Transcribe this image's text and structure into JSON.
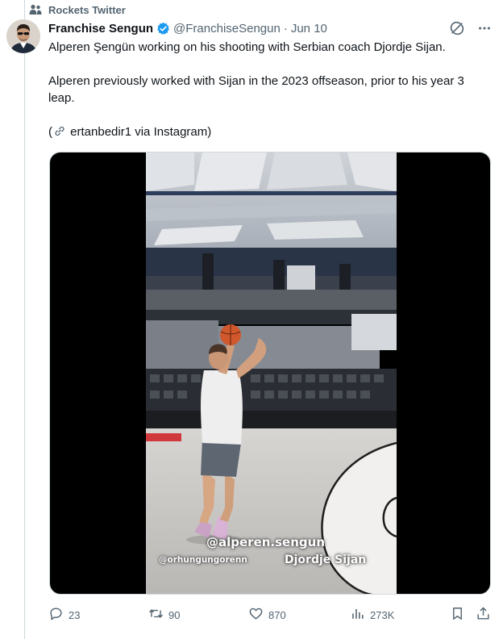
{
  "social_context": {
    "label": "Rockets Twitter",
    "icon": "community-icon"
  },
  "author": {
    "display_name": "Franchise Sengun",
    "verified": true,
    "handle": "@FranchiseSengun",
    "separator": "·",
    "date": "Jun 10"
  },
  "tweet": {
    "line1": "Alperen Şengün working on his shooting with Serbian coach Djordje Sijan.",
    "line2": "Alperen previously worked with Sijan in the 2023 offseason, prior to his year 3 leap.",
    "line3_prefix": "(",
    "line3_text": " ertanbedir1 via Instagram)",
    "link_icon": "link-icon"
  },
  "media": {
    "overlay_main": "@alperen.sengun",
    "overlay_left": "@orhungungorenn",
    "overlay_right": "Djordje Sijan"
  },
  "actions": {
    "replies": "23",
    "reposts": "90",
    "likes": "870",
    "views": "273K"
  },
  "colors": {
    "accent": "#1d9bf0",
    "muted": "#536471",
    "text": "#0f1419",
    "border": "#cfd9de"
  }
}
